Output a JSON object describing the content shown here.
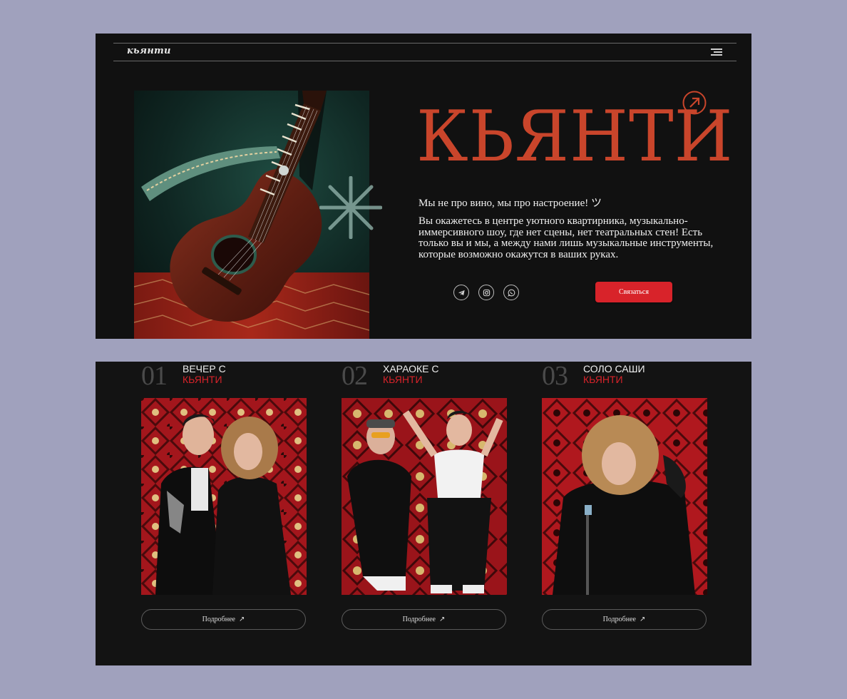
{
  "nav": {
    "logo": "кьянти",
    "menu_icon": "hamburger-menu-icon"
  },
  "hero": {
    "title": "КЬЯНТИ",
    "tagline": "Мы не про вино, мы про настроение! ツ",
    "description": "Вы окажетесь в центре уютного квартирника, музыкально-иммерсивного шоу, где нет сцены, нет театральных стен! Есть только вы и мы, а между нами лишь музыкальные инструменты, которые возможно окажутся в ваших руках.",
    "contact_label": "Связаться",
    "socials": [
      "telegram-icon",
      "instagram-icon",
      "whatsapp-icon"
    ],
    "accent_color": "#c9452b"
  },
  "shows": [
    {
      "number": "01",
      "title_line1": "ВЕЧЕР С",
      "title_line2": "КЬЯНТИ",
      "button": "Подробнее"
    },
    {
      "number": "02",
      "title_line1": "ХАРАОКЕ С",
      "title_line2": "КЬЯНТИ",
      "button": "Подробнее"
    },
    {
      "number": "03",
      "title_line1": "СОЛО САШИ",
      "title_line2": "КЬЯНТИ",
      "button": "Подробнее"
    }
  ],
  "colors": {
    "background": "#a0a1bd",
    "panel": "#111111",
    "button_red": "#d8232a",
    "title_orange": "#c9452b"
  }
}
